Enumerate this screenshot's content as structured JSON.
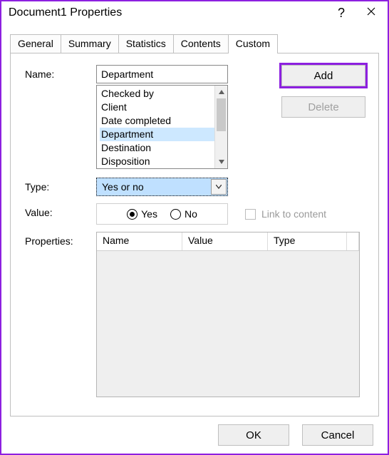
{
  "titlebar": {
    "title": "Document1 Properties"
  },
  "tabs": [
    {
      "label": "General"
    },
    {
      "label": "Summary"
    },
    {
      "label": "Statistics"
    },
    {
      "label": "Contents"
    },
    {
      "label": "Custom"
    }
  ],
  "labels": {
    "name": "Name:",
    "type": "Type:",
    "value": "Value:",
    "properties": "Properties:",
    "link_to_content": "Link to content"
  },
  "name_field": {
    "value": "Department",
    "list": [
      "Checked by",
      "Client",
      "Date completed",
      "Department",
      "Destination",
      "Disposition"
    ],
    "selected_index": 3
  },
  "side_buttons": {
    "add": "Add",
    "delete": "Delete"
  },
  "type_combo": {
    "value": "Yes or no"
  },
  "value_radios": {
    "yes": "Yes",
    "no": "No",
    "selected": "yes"
  },
  "properties_table": {
    "columns": {
      "name": "Name",
      "value": "Value",
      "type": "Type"
    },
    "rows": []
  },
  "footer": {
    "ok": "OK",
    "cancel": "Cancel"
  }
}
